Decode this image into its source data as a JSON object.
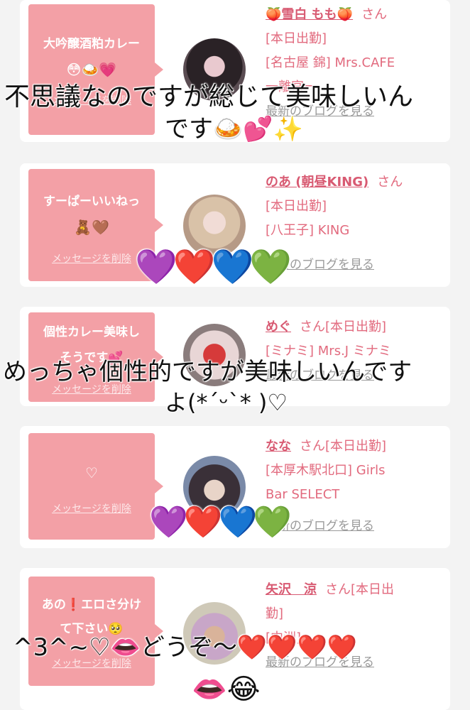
{
  "cards": [
    {
      "message": "大吟醸酒粕カレー",
      "message_emoji": "😳🍛💗",
      "delete_label": "メッセージを削除",
      "name": "🍑雪白 もも🍑",
      "san": "さん",
      "line2": "[本日出勤]",
      "line3": "[名古屋 錦] Mrs.CAFE",
      "line4": "一離宮一",
      "blog": "最新のブログを見る"
    },
    {
      "message": "すーぱーいいねっ",
      "message_emoji": "🧸🤎",
      "delete_label": "メッセージを削除",
      "name": "のあ (朝昼KING)",
      "san": "さん",
      "line2": "[本日出勤]",
      "line3": "[八王子] KING",
      "blog": "最新のブログを見る"
    },
    {
      "message": "個性カレー美味し",
      "message2": "そうです💕",
      "delete_label": "メッセージを削除",
      "name": "めぐ",
      "san": "さん[本日出勤]",
      "line3": "[ミナミ] Mrs.J ミナミ",
      "blog": "最新のブログを見る"
    },
    {
      "message": "♡",
      "delete_label": "メッセージを削除",
      "name": "なな",
      "san": "さん[本日出勤]",
      "line3": "[本厚木駅北口] Girls",
      "line4": "Bar SELECT",
      "blog": "最新のブログを見る"
    },
    {
      "message": "あの❗エロさ分け",
      "message2": "て下さい🥺",
      "delete_label": "メッセージを削除",
      "name": "矢沢　涼",
      "san": "さん[本日出",
      "line2": "勤]",
      "line3": "[中洲]",
      "blog": "最新のブログを見る"
    }
  ],
  "overlays": {
    "text1": "不思議なのですが総じて美味しいん",
    "text1b": "です🍛💕✨",
    "hearts1": "💜❤️💙💚",
    "text2": "めっちゃ個性的ですが美味しいんです",
    "text2b": "よ(*ˊᵕˋ* )♡",
    "hearts2": "💜❤️💙💚",
    "text3": "^3^~♡👄どうぞ〜❤️❤️❤️❤️",
    "text3b": "👄😂"
  }
}
